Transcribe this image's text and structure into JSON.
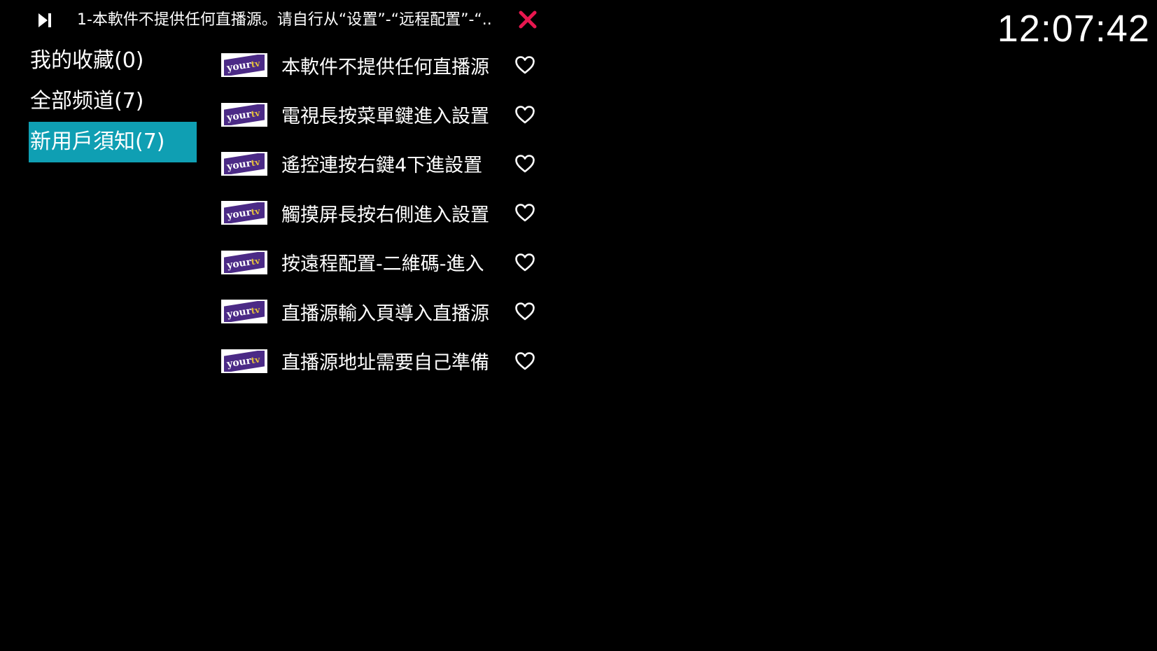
{
  "top_bar": {
    "skip_icon": "skip-next-icon",
    "marquee_text": "1-本軟件不提供任何直播源。请自行从“设置”-“远程配置”-“..",
    "close_icon": "close-icon",
    "close_color": "#e8174f",
    "clock": "12:07:42"
  },
  "categories": [
    {
      "label": "我的收藏(0)"
    },
    {
      "label": "全部频道(7)"
    },
    {
      "label": "新用戶須知(7)"
    }
  ],
  "active_category_index": 2,
  "accent_color": "#0f9fb3",
  "channels": [
    {
      "name": "本軟件不提供任何直播源",
      "logo_text": "your",
      "logo_text_2": "tv",
      "fav_icon": "heart-outline-icon"
    },
    {
      "name": "電視長按菜單鍵進入設置",
      "logo_text": "your",
      "logo_text_2": "tv",
      "fav_icon": "heart-outline-icon"
    },
    {
      "name": "遙控連按右鍵4下進設置",
      "logo_text": "your",
      "logo_text_2": "tv",
      "fav_icon": "heart-outline-icon"
    },
    {
      "name": "觸摸屏長按右側進入設置",
      "logo_text": "your",
      "logo_text_2": "tv",
      "fav_icon": "heart-outline-icon"
    },
    {
      "name": "按遠程配置-二維碼-進入",
      "logo_text": "your",
      "logo_text_2": "tv",
      "fav_icon": "heart-outline-icon"
    },
    {
      "name": "直播源輸入頁導入直播源",
      "logo_text": "your",
      "logo_text_2": "tv",
      "fav_icon": "heart-outline-icon"
    },
    {
      "name": "直播源地址需要自己準備",
      "logo_text": "your",
      "logo_text_2": "tv",
      "fav_icon": "heart-outline-icon"
    }
  ]
}
